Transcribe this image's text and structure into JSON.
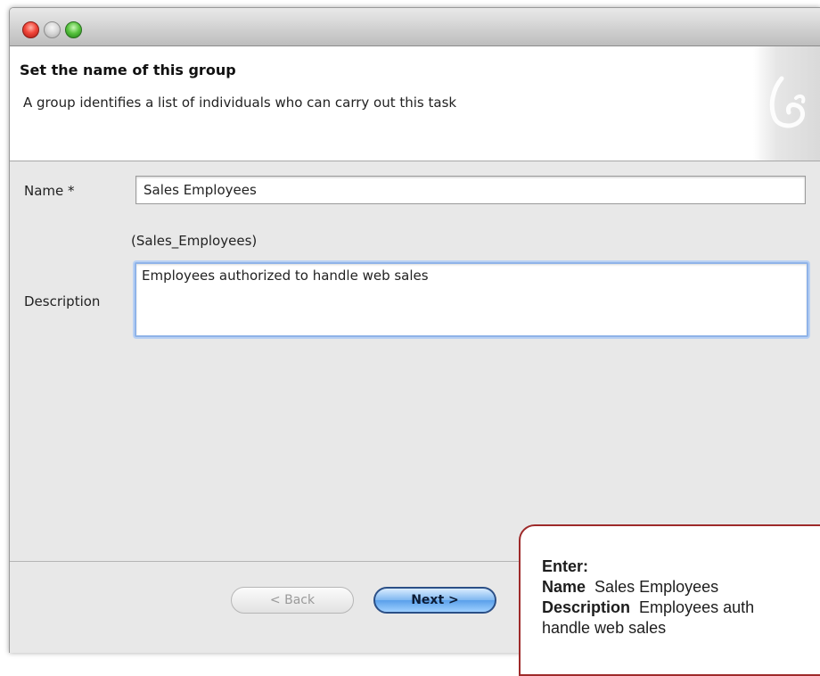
{
  "header": {
    "title": "Set the name of this group",
    "description": "A group identifies a list of individuals who can carry out this task"
  },
  "form": {
    "name_label": "Name *",
    "name_value": "Sales Employees",
    "id_text": "(Sales_Employees)",
    "description_label": "Description",
    "description_value": "Employees authorized to handle web sales"
  },
  "buttons": {
    "back_label": "< Back",
    "next_label": "Next >"
  },
  "callout": {
    "heading": "Enter:",
    "name_key": "Name",
    "name_value": "Sales Employees",
    "description_key": "Description",
    "description_value": "Employees auth",
    "description_cont": "handle web sales"
  },
  "colors": {
    "accent_focus": "#8fb3e8",
    "next_button": "#5aa0ea",
    "callout_border": "#9e2a2a"
  },
  "icons": [
    "close-icon",
    "minimize-icon",
    "zoom-icon",
    "bonita-logo-icon"
  ]
}
